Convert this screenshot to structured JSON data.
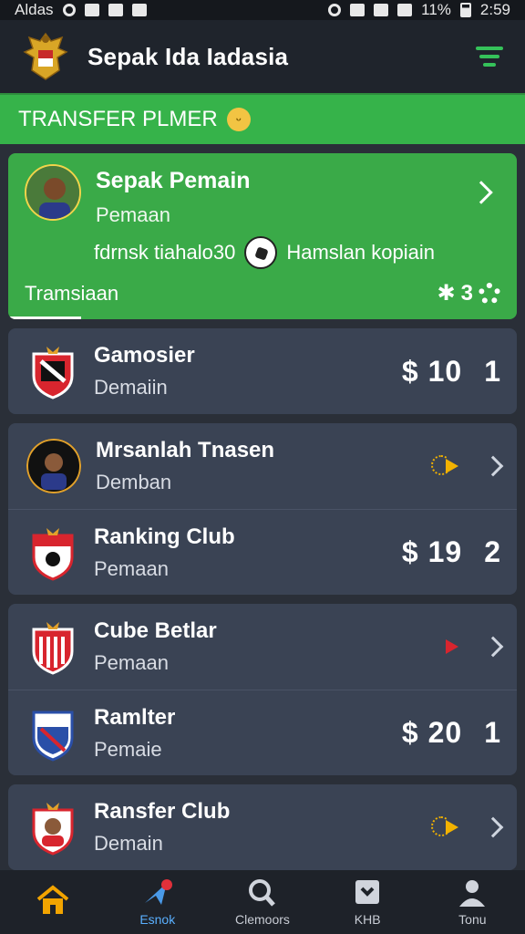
{
  "status_bar": {
    "carrier": "Aldas",
    "battery_text": "11%",
    "time": "2:59"
  },
  "header": {
    "title": "Sepak Ida Iadasia"
  },
  "banner": {
    "label": "TRANSFER PLMER"
  },
  "featured": {
    "name": "Sepak Pemain",
    "subtitle": "Pemaan",
    "info_left": "fdrnsk tiahalo30",
    "info_right": "Hamslan kopiain",
    "footer_label": "Tramsiaan",
    "count": "3"
  },
  "groups": [
    {
      "rows": [
        {
          "name": "Gamosier",
          "subtitle": "Demaiin",
          "price": "$ 10",
          "rank": "1",
          "logo_color": "#d8252e"
        }
      ]
    },
    {
      "rows": [
        {
          "name": "Mrsanlah Tnasen",
          "subtitle": "Demban",
          "price": "",
          "rank": "",
          "logo_color": "#111111"
        },
        {
          "name": "Ranking Club",
          "subtitle": "Pemaan",
          "price": "$ 19",
          "rank": "2",
          "logo_color": "#d8252e"
        }
      ]
    },
    {
      "rows": [
        {
          "name": "Cube Betlar",
          "subtitle": "Pemaan",
          "price": "",
          "rank": "",
          "logo_color": "#d8252e"
        },
        {
          "name": "Ramlter",
          "subtitle": "Pemaie",
          "price": "$ 20",
          "rank": "1",
          "logo_color": "#2a4fa8"
        }
      ]
    },
    {
      "rows": [
        {
          "name": "Ransfer Club",
          "subtitle": "Demain",
          "price": "",
          "rank": "",
          "logo_color": "#d8252e"
        }
      ]
    }
  ],
  "bottom_nav": [
    {
      "label": "",
      "icon": "home-icon"
    },
    {
      "label": "Esnok",
      "icon": "send-icon"
    },
    {
      "label": "Clemoors",
      "icon": "search-icon"
    },
    {
      "label": "KHB",
      "icon": "grid-icon"
    },
    {
      "label": "Tonu",
      "icon": "profile-icon"
    }
  ],
  "colors": {
    "accent_green": "#36b34a",
    "card_bg": "#3a4354",
    "header_bg": "#1f242c",
    "active_nav": "#5ab0ff"
  }
}
